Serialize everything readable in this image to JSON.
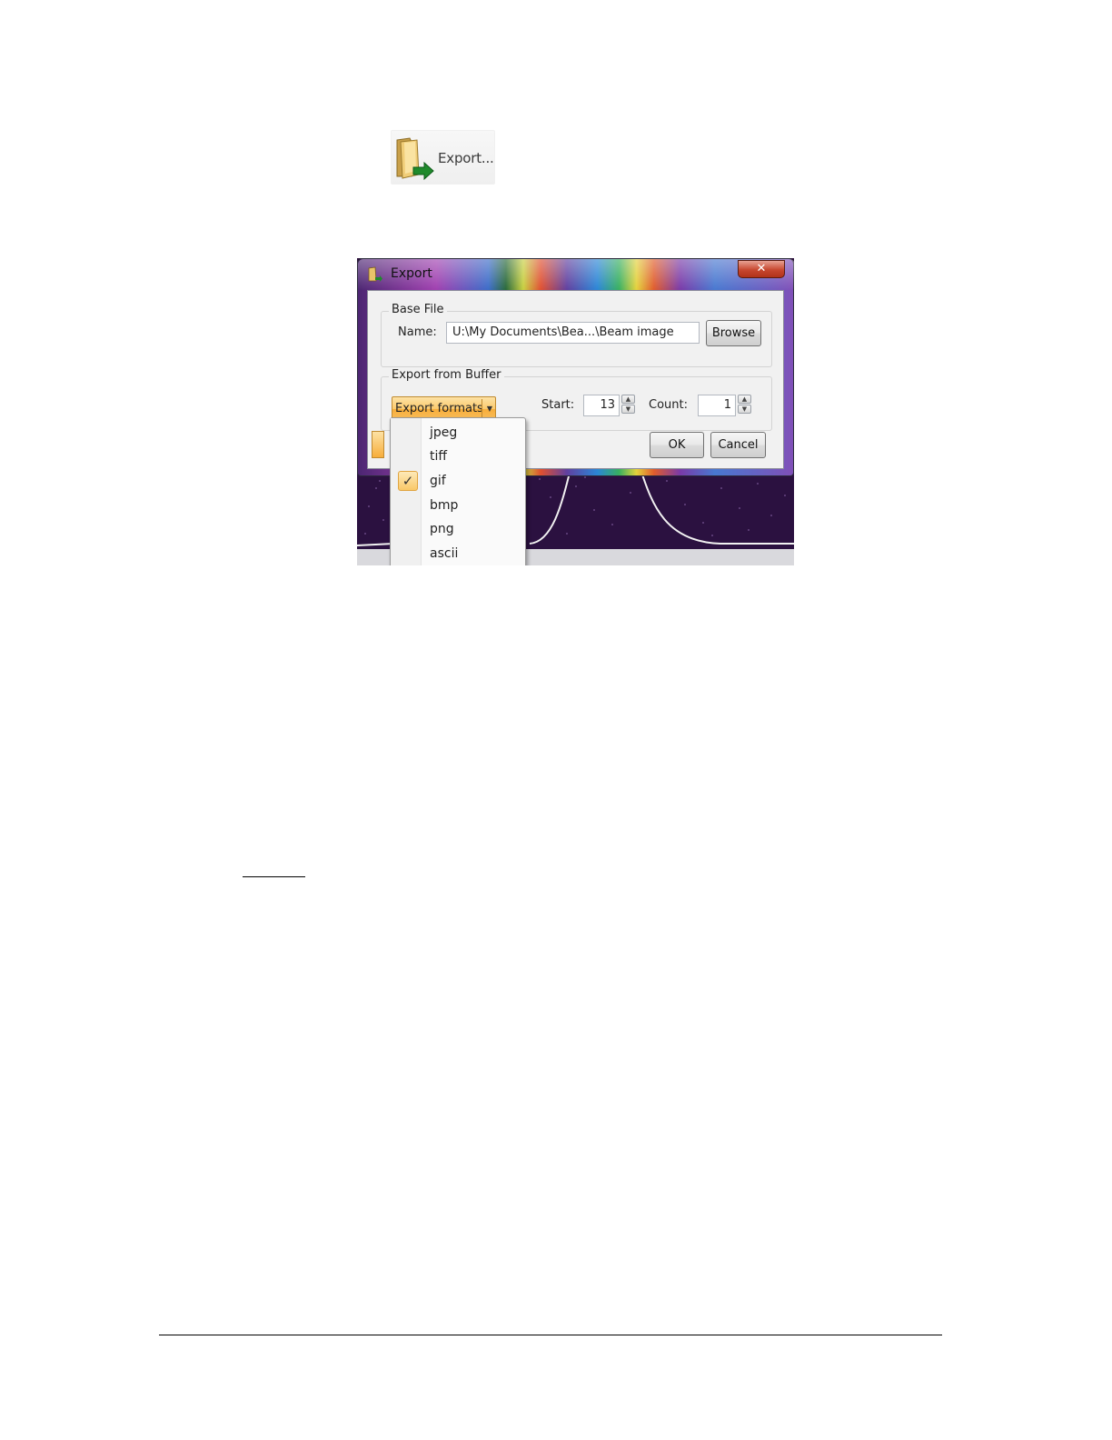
{
  "toolbar": {
    "export_label": "Export...",
    "export_icon": "folder-export-icon"
  },
  "dialog": {
    "title": "Export",
    "close_label": "✕",
    "base_file": {
      "group_title": "Base File",
      "name_label": "Name:",
      "name_value": "U:\\My Documents\\Bea...\\Beam image",
      "browse_label": "Browse"
    },
    "export_from_buffer": {
      "group_title": "Export from Buffer",
      "formats_button_label": "Export formats",
      "start_label": "Start:",
      "start_value": "13",
      "count_label": "Count:",
      "count_value": "1"
    },
    "ok_label": "OK",
    "cancel_label": "Cancel"
  },
  "format_menu": {
    "items": [
      "jpeg",
      "tiff",
      "gif",
      "bmp",
      "png",
      "ascii"
    ],
    "selected": "gif",
    "check_glyph": "✓"
  },
  "colors": {
    "accent_orange": "#f9c060",
    "close_red": "#c7472f"
  }
}
